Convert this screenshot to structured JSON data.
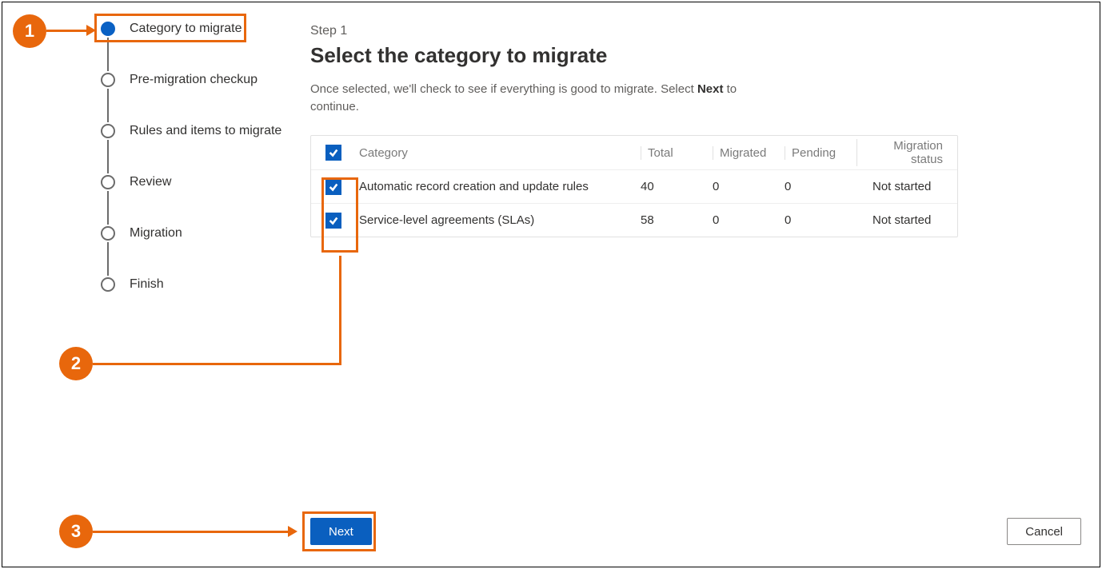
{
  "sidebar": {
    "steps": [
      {
        "label": "Category to migrate",
        "active": true
      },
      {
        "label": "Pre-migration checkup",
        "active": false
      },
      {
        "label": "Rules and items to migrate",
        "active": false
      },
      {
        "label": "Review",
        "active": false
      },
      {
        "label": "Migration",
        "active": false
      },
      {
        "label": "Finish",
        "active": false
      }
    ]
  },
  "main": {
    "step_label": "Step 1",
    "title": "Select the category to migrate",
    "desc_before": "Once selected, we'll check to see if everything is good to migrate. Select ",
    "desc_bold": "Next",
    "desc_after": " to continue."
  },
  "table": {
    "headers": {
      "category": "Category",
      "total": "Total",
      "migrated": "Migrated",
      "pending": "Pending",
      "status": "Migration status"
    },
    "rows": [
      {
        "category": "Automatic record creation and update rules",
        "total": "40",
        "migrated": "0",
        "pending": "0",
        "status": "Not started",
        "checked": true
      },
      {
        "category": "Service-level agreements (SLAs)",
        "total": "58",
        "migrated": "0",
        "pending": "0",
        "status": "Not started",
        "checked": true
      }
    ]
  },
  "buttons": {
    "next": "Next",
    "cancel": "Cancel"
  },
  "annotations": {
    "b1": "1",
    "b2": "2",
    "b3": "3"
  }
}
